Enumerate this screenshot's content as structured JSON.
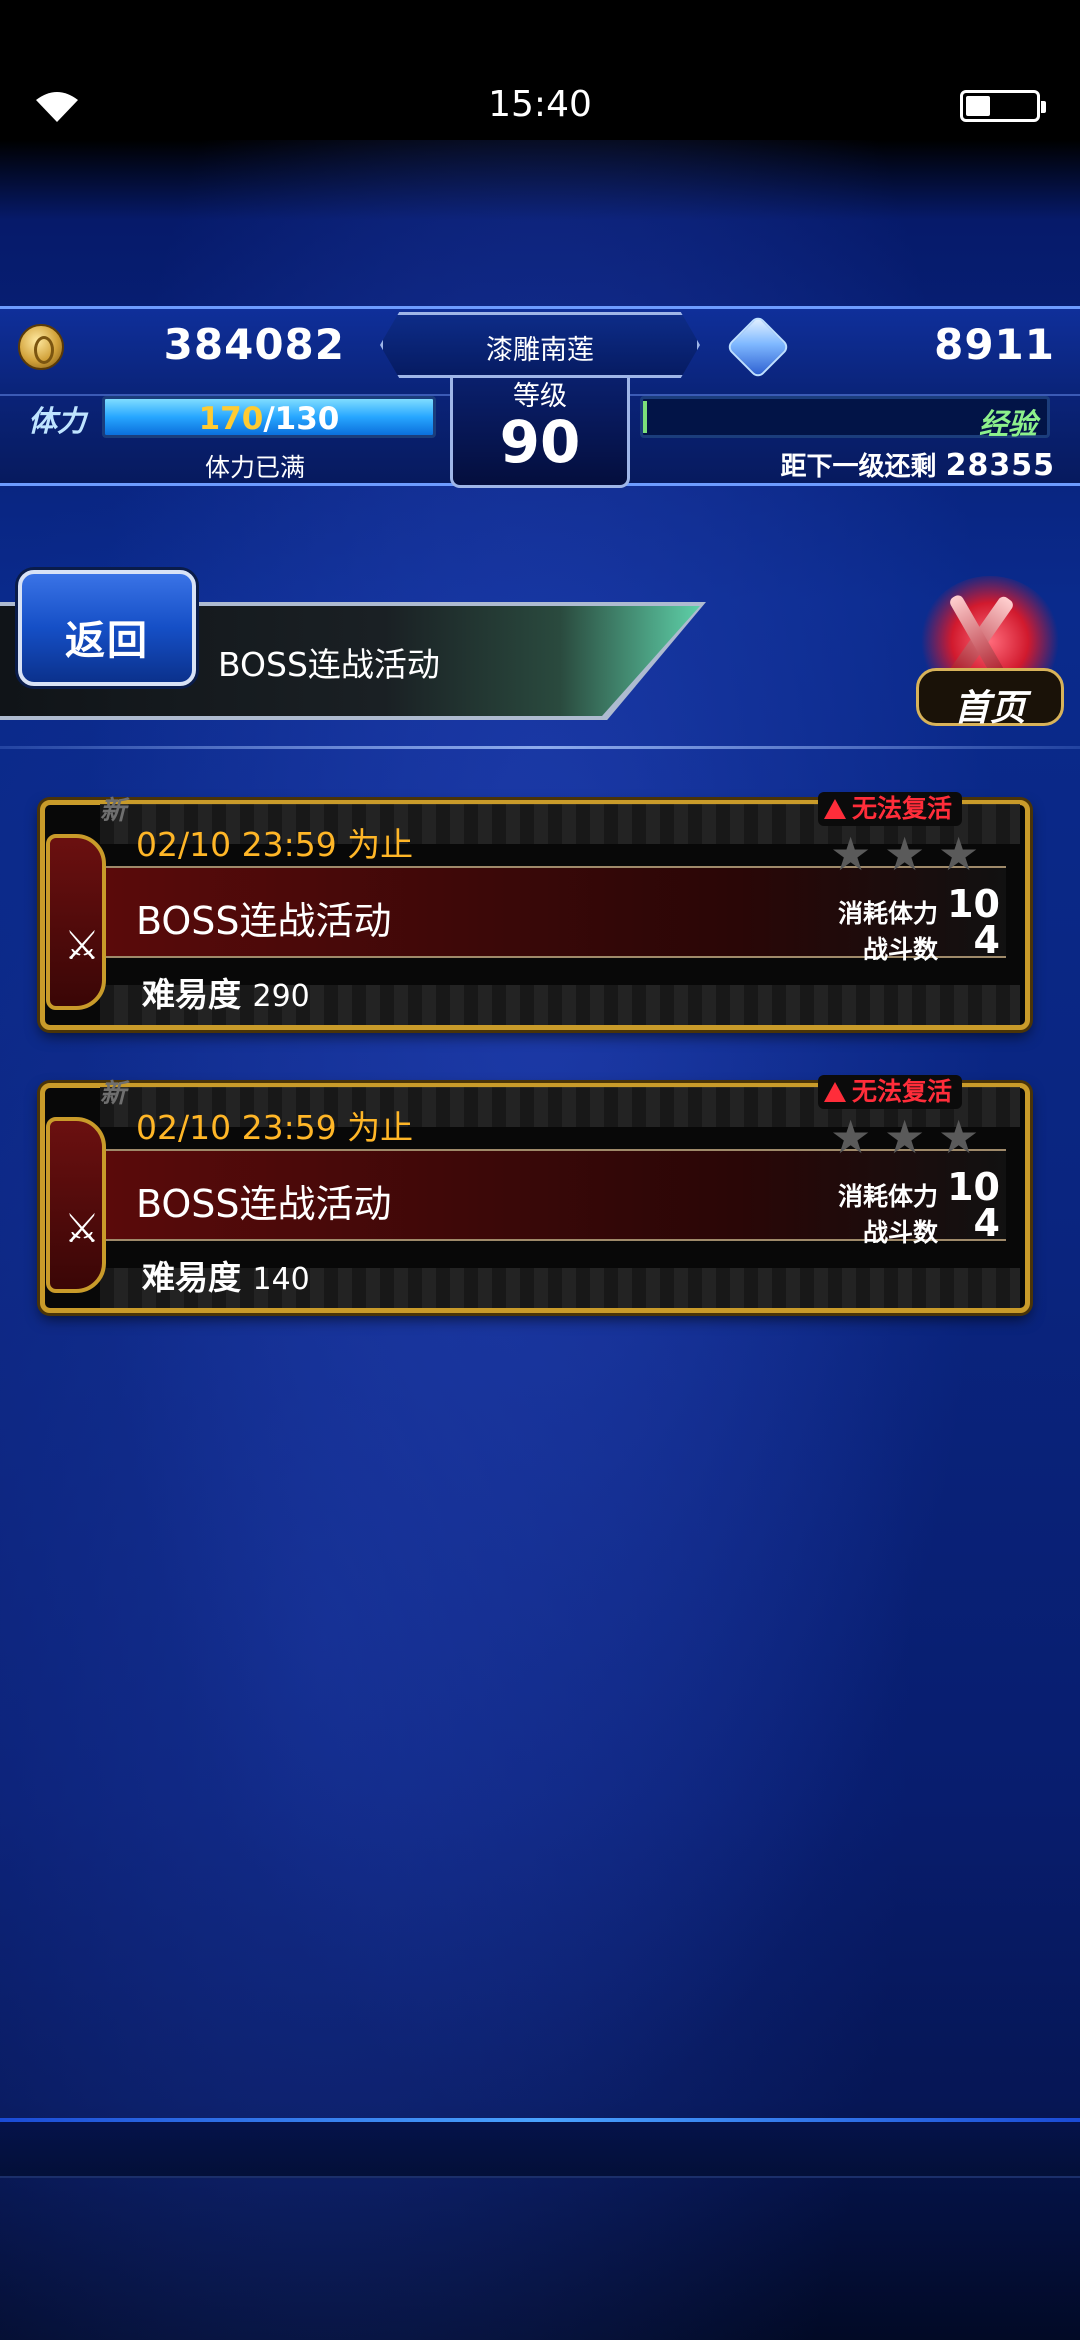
{
  "status_bar": {
    "time": "15:40",
    "battery_level": 0.35
  },
  "hud": {
    "gil": "384082",
    "gems": "8911",
    "player_name": "漆雕南莲",
    "level_label": "等级",
    "level": "90",
    "stamina_label": "体力",
    "stamina_current": "170",
    "stamina_max": "/130",
    "stamina_fill": 1.0,
    "stamina_status": "体力已满",
    "exp_label": "经验",
    "exp_fill": 0.01,
    "next_level_label": "距下一级还剩",
    "next_level_value": "28355"
  },
  "header": {
    "back_label": "返回",
    "title": "BOSS连战活动",
    "home_label": "首页"
  },
  "events": [
    {
      "new_badge": "新",
      "deadline": "02/10 23:59  为止",
      "title": "BOSS连战活动",
      "no_revive": "无法复活",
      "stamina_cost_label": "消耗体力",
      "stamina_cost": "10",
      "battles_label": "战斗数",
      "battles": "4",
      "difficulty_label": "难易度",
      "difficulty": "290",
      "stars_earned": 0,
      "stars_total": 3
    },
    {
      "new_badge": "新",
      "deadline": "02/10 23:59  为止",
      "title": "BOSS连战活动",
      "no_revive": "无法复活",
      "stamina_cost_label": "消耗体力",
      "stamina_cost": "10",
      "battles_label": "战斗数",
      "battles": "4",
      "difficulty_label": "难易度",
      "difficulty": "140",
      "stars_earned": 0,
      "stars_total": 3
    }
  ],
  "colors": {
    "deadline": "#ffb627",
    "no_revive": "#ff2d3a",
    "card_border": "#c99b2a",
    "stamina_current": "#ffcb32",
    "exp_label": "#8df08b"
  },
  "icons": {
    "wifi": "wifi-icon",
    "battery": "battery-icon",
    "gil": "gil-coin-icon",
    "gems": "gem-icon",
    "event": "crossed-swords-icon",
    "difficulty_stars": "star-icon",
    "warning": "warning-icon",
    "home": "home-swords-icon"
  }
}
